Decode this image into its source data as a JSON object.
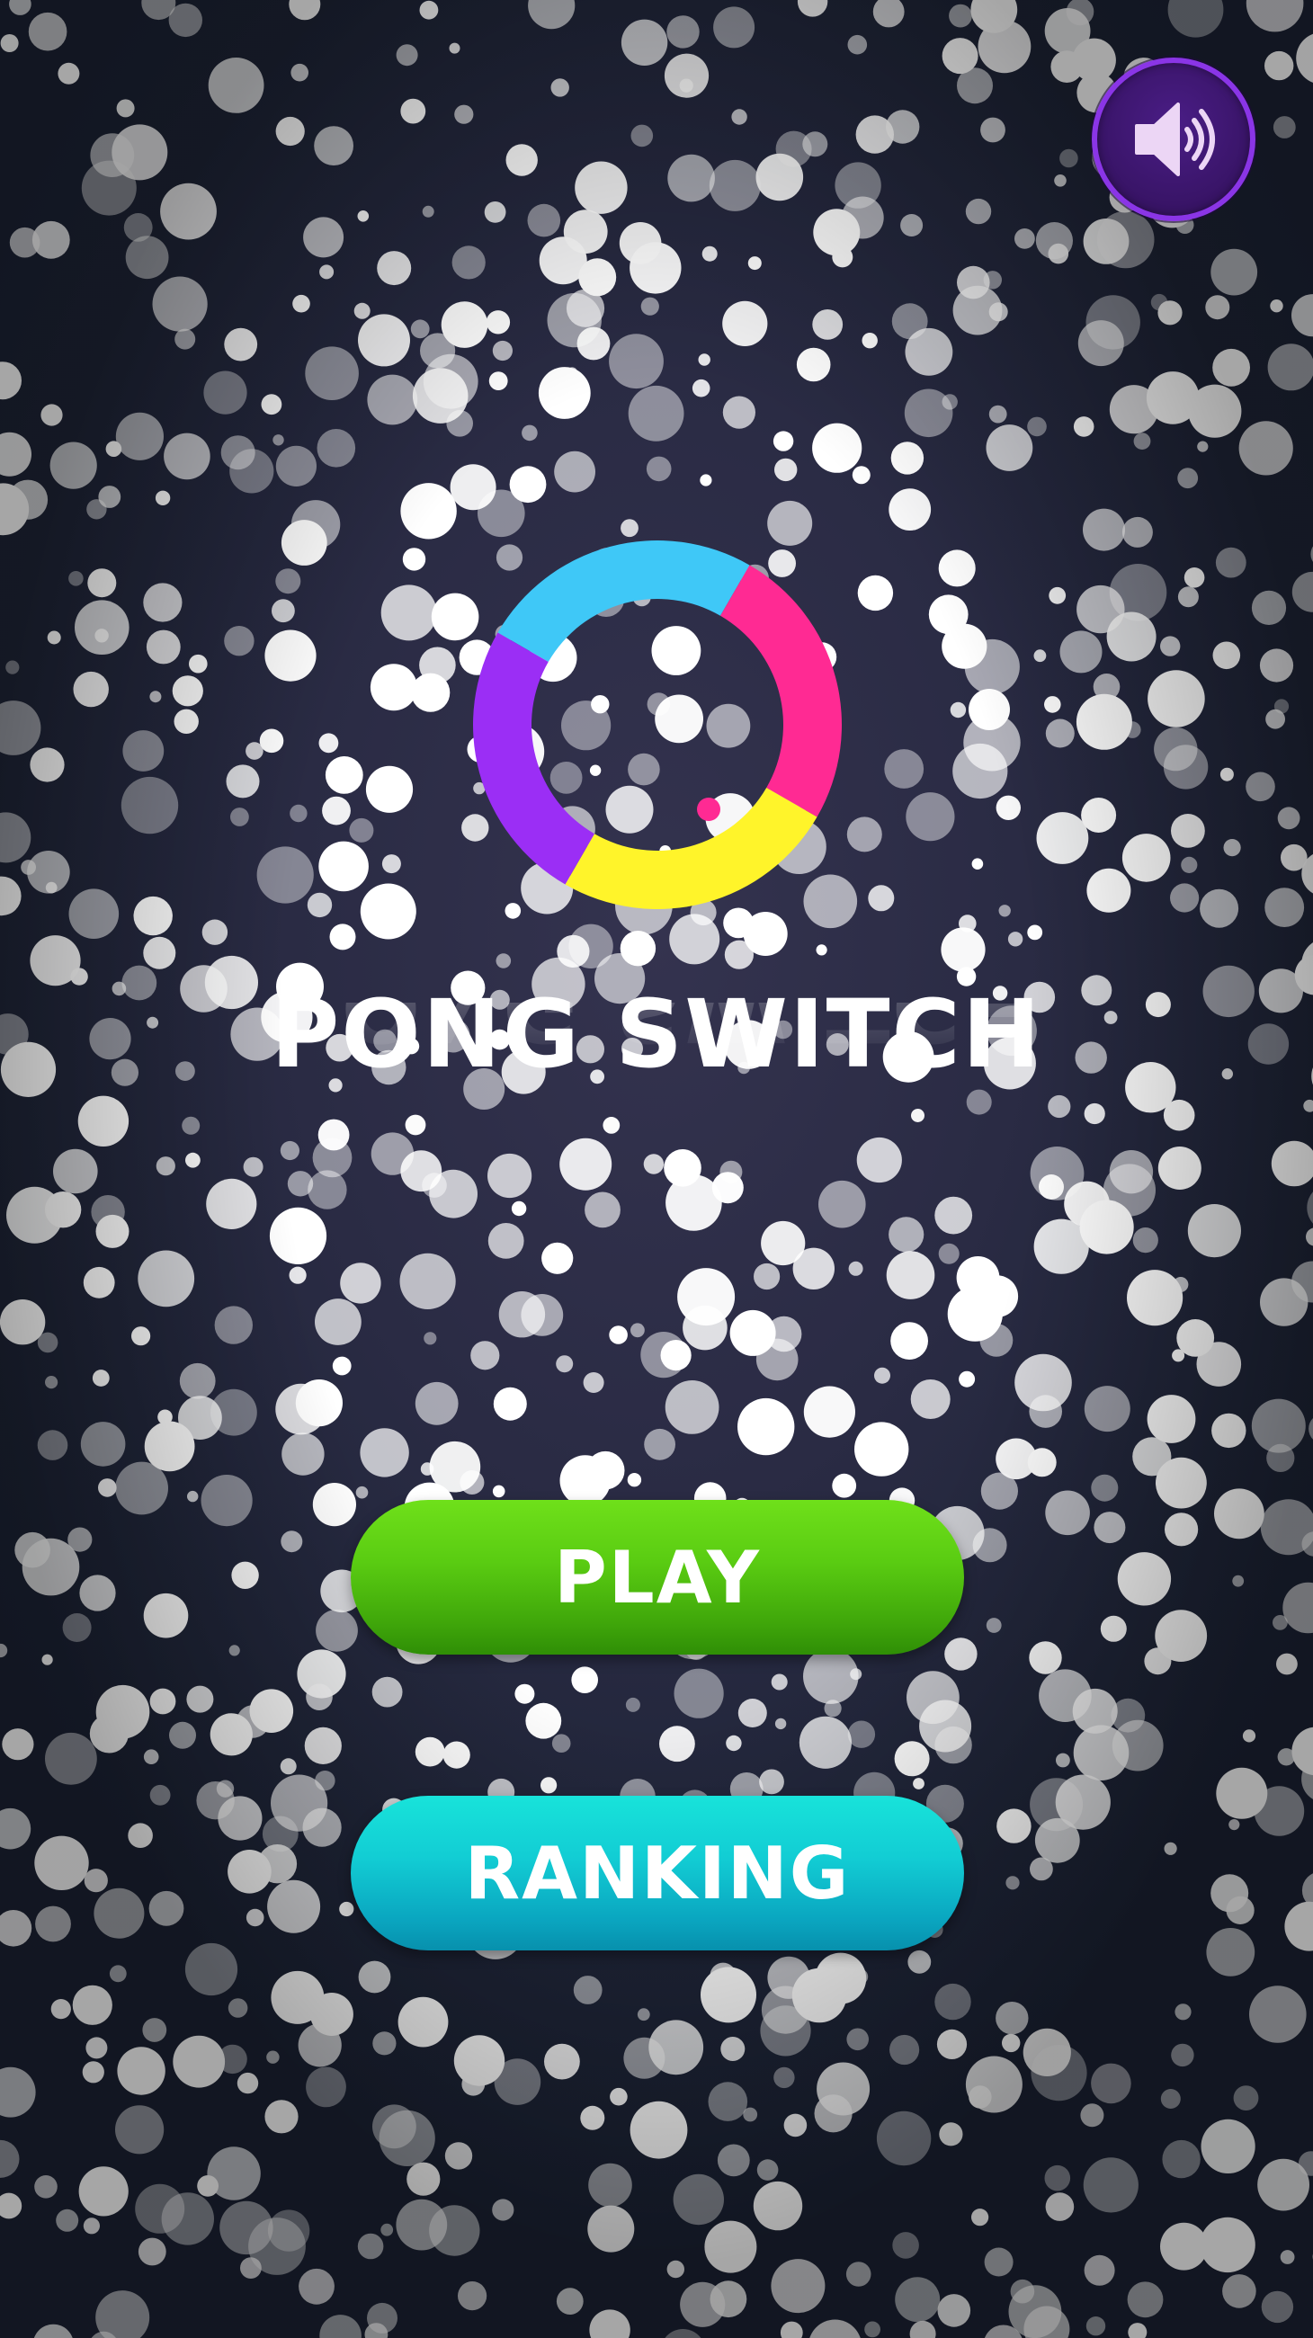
{
  "game": {
    "title": "PONG SWITCH"
  },
  "controls": {
    "sound_icon": "speaker-volume-icon",
    "play_label": "PLAY",
    "ranking_label": "RANKING"
  },
  "logo": {
    "segments": [
      {
        "color": "#3fc8f7",
        "name": "cyan"
      },
      {
        "color": "#ff2a93",
        "name": "pink"
      },
      {
        "color": "#fff42a",
        "name": "yellow"
      },
      {
        "color": "#9b2ef5",
        "name": "purple"
      }
    ],
    "ball_color": "#ff2a93"
  },
  "colors": {
    "background": "#2a2b44",
    "play_button": "#4fbf0f",
    "ranking_button": "#0fbccc",
    "sound_button_ring": "#8a35e6",
    "sound_button_fill": "#3a1568",
    "text": "#ffffff"
  }
}
